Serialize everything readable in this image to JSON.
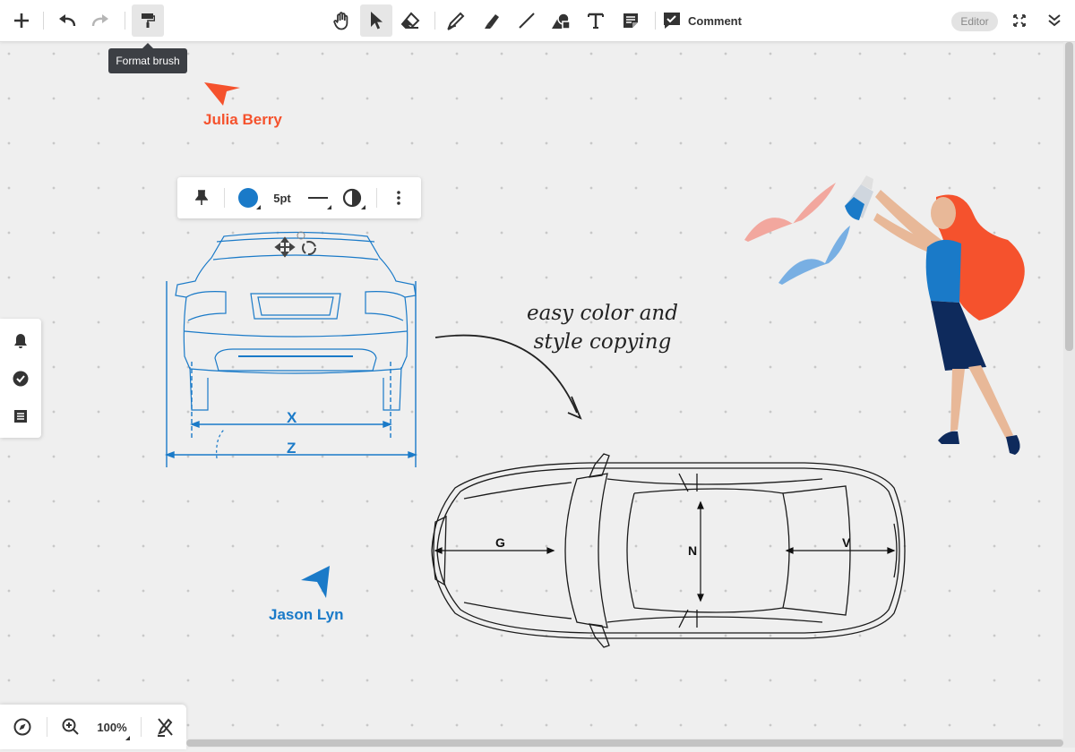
{
  "toolbar": {
    "tooltip": "Format brush",
    "comment_label": "Comment",
    "mode_badge": "Editor"
  },
  "cursors": [
    {
      "name": "Julia Berry",
      "color": "#f5522d"
    },
    {
      "name": "Jason Lyn",
      "color": "#1a7ac8"
    }
  ],
  "shape_toolbar": {
    "color": "#1a7ac8",
    "stroke_width": "5pt"
  },
  "canvas": {
    "note_line1": "easy color and",
    "note_line2": "style copying",
    "rear_view_labels": [
      "X",
      "Z"
    ],
    "top_view_labels": [
      "G",
      "N",
      "V"
    ]
  },
  "zoom": {
    "level": "100%"
  },
  "icons": {
    "add": "plus-icon",
    "undo": "undo-icon",
    "redo": "redo-icon",
    "format_brush": "paint-roller-icon",
    "hand": "hand-icon",
    "select": "pointer-icon",
    "eraser": "eraser-icon",
    "pen": "pen-icon",
    "highlighter": "highlighter-icon",
    "line": "line-icon",
    "shapes": "shapes-icon",
    "text": "text-icon",
    "sticky": "sticky-note-icon",
    "fullscreen": "fullscreen-icon",
    "collapse": "chevron-double-down-icon"
  }
}
